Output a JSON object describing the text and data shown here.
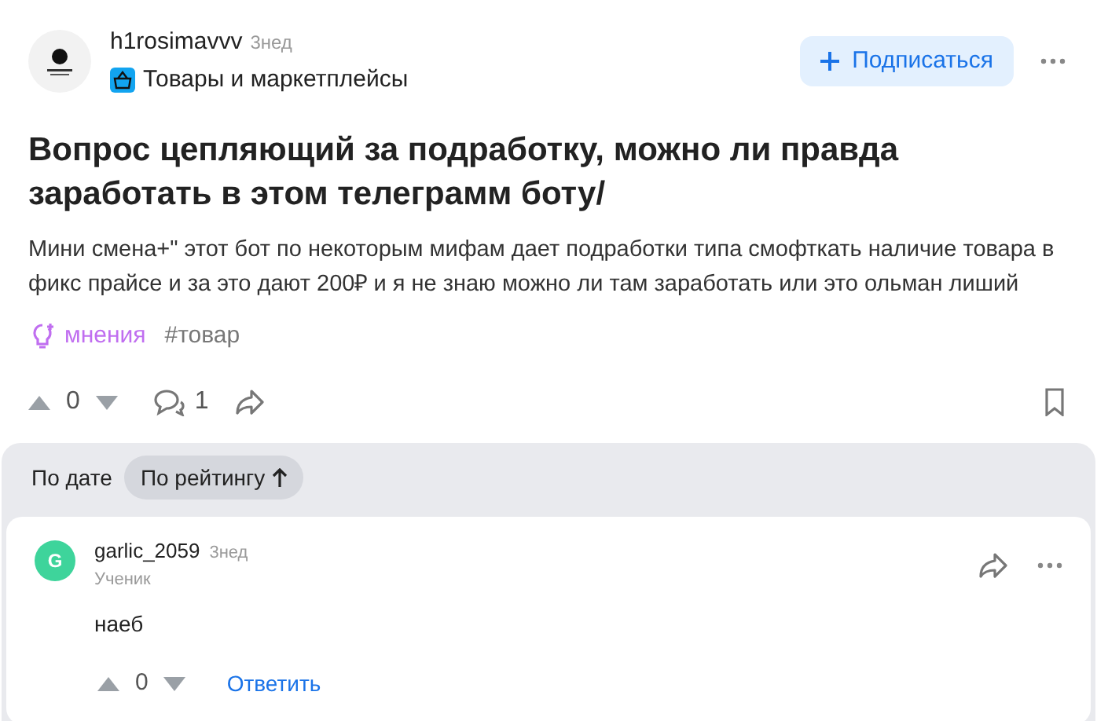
{
  "post": {
    "author": "h1rosimavvv",
    "time": "3нед",
    "category": "Товары и маркетплейсы",
    "subscribe": "Подписаться",
    "title": "Вопрос цепляющий за подработку, можно ли правда заработать в этом телеграмм боту/",
    "body": "Мини смена+\" этот бот по некоторым мифам дает подработки типа смофткать наличие товара в фикс прайсе и за это дают 200₽ и я не знаю можно ли там заработать или это ольман лиший",
    "tags": [
      {
        "kind": "topic",
        "label": "мнения"
      },
      {
        "kind": "hashtag",
        "label": "#товар"
      }
    ],
    "score": "0",
    "comments": "1"
  },
  "sort_tabs": [
    {
      "label": "По дате",
      "selected": false
    },
    {
      "label": "По рейтингу",
      "selected": true
    }
  ],
  "comments": [
    {
      "initial": "G",
      "color": "#3ed49b",
      "author": "garlic_2059",
      "time": "3нед",
      "rank": "Ученик",
      "text": "наеб",
      "score": "0",
      "reply": "Ответить"
    }
  ]
}
